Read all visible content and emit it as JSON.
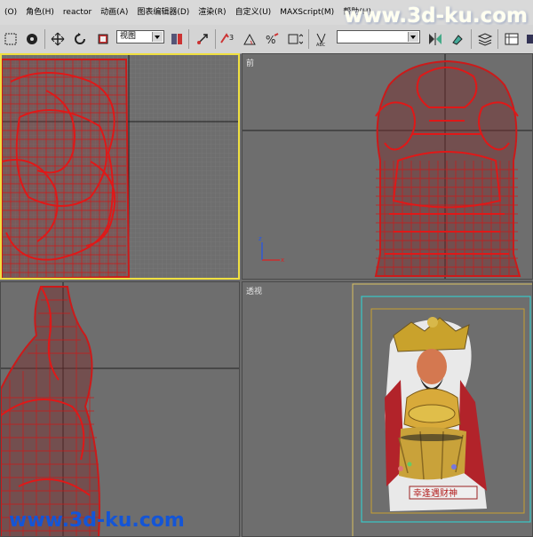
{
  "menu": {
    "items": [
      "(O)",
      "角色(H)",
      "reactor",
      "动画(A)",
      "图表编辑器(D)",
      "渲染(R)",
      "自定义(U)",
      "MAXScript(M)",
      "帮助(H)"
    ]
  },
  "watermark": {
    "top": "www.3d-ku.com",
    "bottom": "www.3d-ku.com"
  },
  "toolbar": {
    "coord_dropdown_value": "视图",
    "named_selection_value": ""
  },
  "viewports": {
    "front_label": "前",
    "perspective_label": "透视"
  },
  "colors": {
    "wireframe": "#cc1a1a",
    "active_border": "#f0e040",
    "viewport_bg": "#6e6e6e",
    "safe_frame_outer": "#38c8c8",
    "safe_frame_inner": "#c8a030"
  },
  "render_caption": "幸逢遇财神"
}
